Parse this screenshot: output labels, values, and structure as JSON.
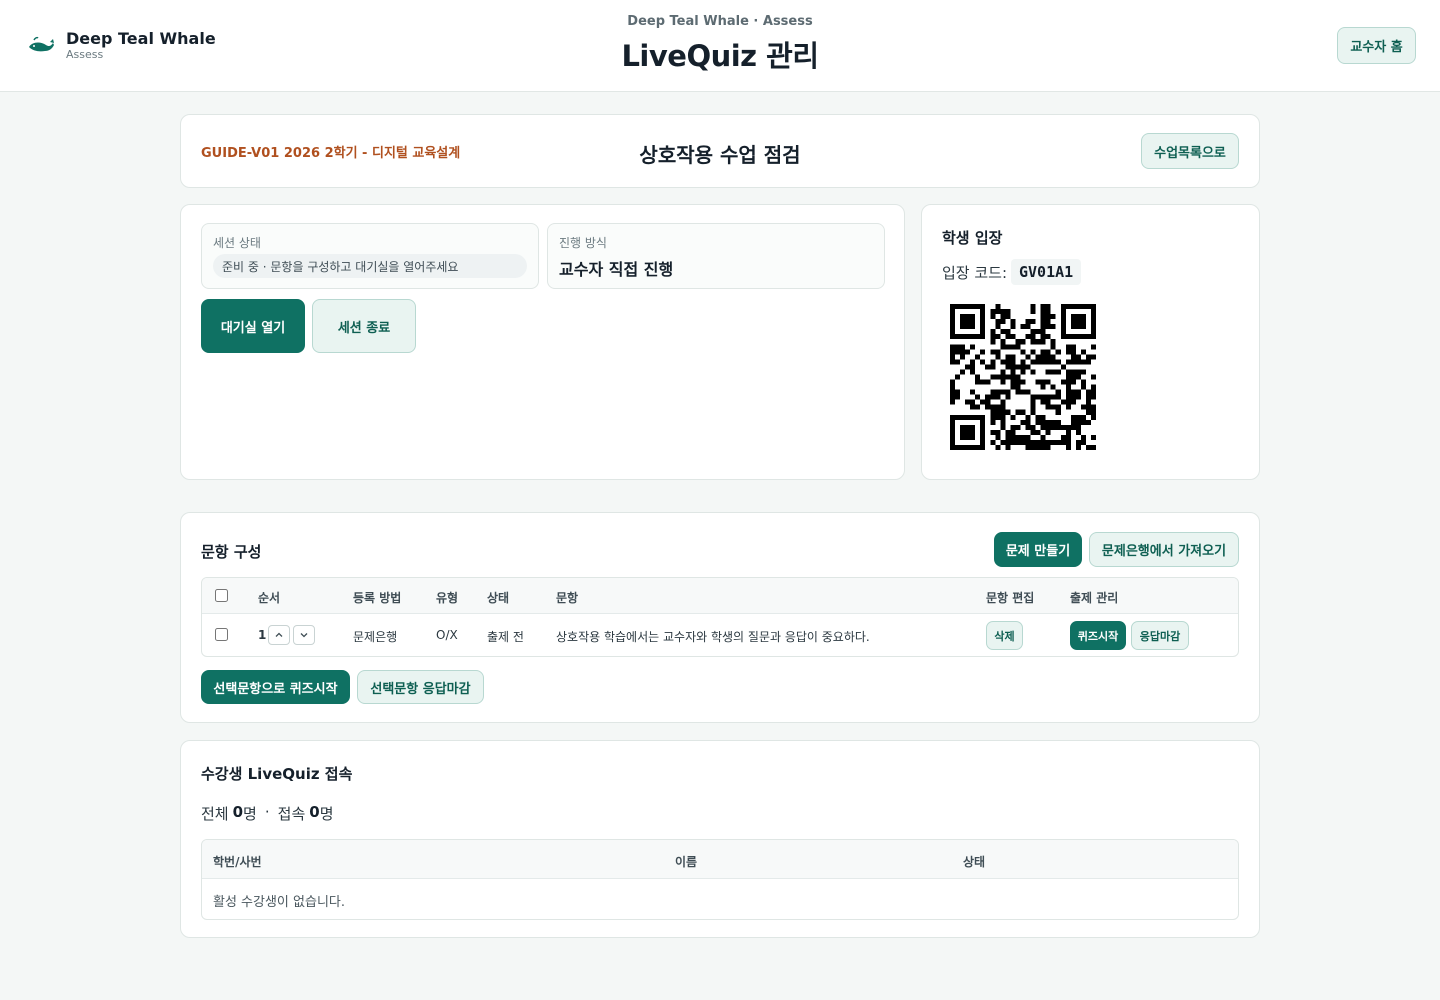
{
  "header": {
    "brand_name": "Deep Teal Whale",
    "brand_sub": "Assess",
    "kicker": "Deep Teal Whale · Assess",
    "title": "LiveQuiz 관리",
    "home_button": "교수자 홈"
  },
  "course": {
    "code": "GUIDE-V01 2026 2학기 - 디지털 교육설계",
    "title": "상호작용 수업 점검",
    "back_button": "수업목록으로"
  },
  "session": {
    "status_label": "세션 상태",
    "status_value": "준비 중 · 문항을 구성하고 대기실을 열어주세요",
    "mode_label": "진행 방식",
    "mode_value": "교수자 직접 진행",
    "open_button": "대기실 열기",
    "end_button": "세션 종료"
  },
  "entry": {
    "title": "학생 입장",
    "code_label": "입장 코드:",
    "code": "GV01A1"
  },
  "questions": {
    "title": "문항 구성",
    "create_button": "문제 만들기",
    "import_button": "문제은행에서 가져오기",
    "columns": [
      "순서",
      "등록 방법",
      "유형",
      "상태",
      "문항",
      "문항 편집",
      "출제 관리"
    ],
    "rows": [
      {
        "order": "1",
        "method": "문제은행",
        "type": "O/X",
        "status": "출제 전",
        "text": "상호작용 학습에서는 교수자와 학생의 질문과 응답이 중요하다.",
        "delete_label": "삭제",
        "start_label": "퀴즈시작",
        "close_label": "응답마감"
      }
    ],
    "start_selected_button": "선택문항으로 퀴즈시작",
    "close_selected_button": "선택문항 응답마감"
  },
  "students": {
    "title": "수강생 LiveQuiz 접속",
    "total_label": "전체",
    "total_count": "0",
    "unit": "명",
    "sep": "·",
    "connected_label": "접속",
    "connected_count": "0",
    "columns": [
      "학번/사번",
      "이름",
      "상태"
    ],
    "empty_message": "활성 수강생이 없습니다."
  },
  "colors": {
    "accent": "#0f7163",
    "accent_light": "#e9f4f1",
    "course_code": "#b0501f"
  }
}
